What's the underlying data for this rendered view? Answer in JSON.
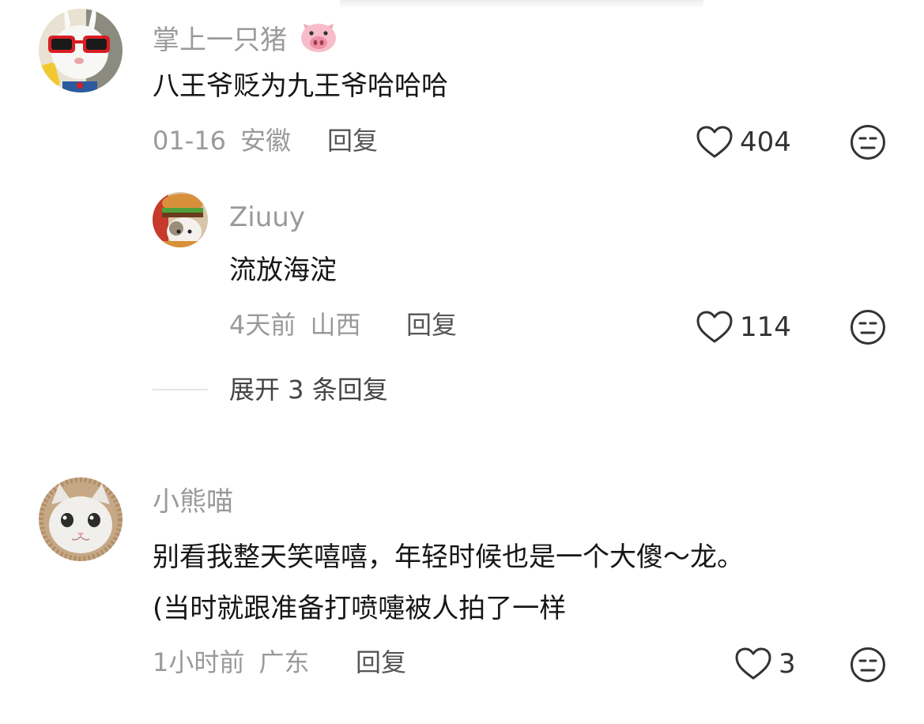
{
  "comments": [
    {
      "username": "掌上一只猪",
      "username_emoji": "pig-face",
      "text": "八王爷贬为九王爷哈哈哈",
      "date": "01-16",
      "location": "安徽",
      "reply_label": "回复",
      "likes": "404",
      "replies": [
        {
          "username": "Ziuuy",
          "text": "流放海淀",
          "date": "4天前",
          "location": "山西",
          "reply_label": "回复",
          "likes": "114"
        }
      ],
      "expand_label": "展开 3 条回复"
    },
    {
      "username": "小熊喵",
      "text_line1": "别看我整天笑嘻嘻，年轻时候也是一个大傻～龙。",
      "text_line2": "(当时就跟准备打喷嚏被人拍了一样",
      "date": "1小时前",
      "location": "广东",
      "reply_label": "回复",
      "likes": "3"
    }
  ],
  "icons": {
    "like": "heart-outline-icon",
    "reaction": "unamused-face-icon"
  },
  "colors": {
    "username": "#9a9a9a",
    "text": "#161616",
    "icon": "#333333"
  }
}
